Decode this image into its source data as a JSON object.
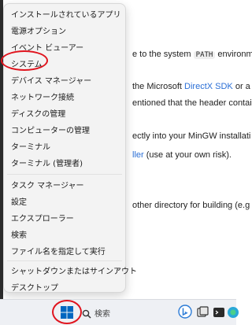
{
  "background_doc": {
    "line1_text": "e to the system",
    "line1_code": "PATH",
    "line1_rest": "environme",
    "line2_text": "the Microsoft",
    "line2_link": "DirectX SDK",
    "line2_rest": "or a",
    "line3_text": "entioned that the header contain",
    "line4_text": "ectly into your MinGW installati",
    "line5_link": "ller",
    "line5_rest": "(use at your own risk).",
    "line6_text": "other directory for building (e.g"
  },
  "menu": {
    "items": [
      {
        "label": "インストールされているアプリ"
      },
      {
        "label": "電源オプション"
      },
      {
        "label": "イベント ビューアー"
      },
      {
        "label": "システム"
      },
      {
        "label": "デバイス マネージャー"
      },
      {
        "label": "ネットワーク接続"
      },
      {
        "label": "ディスクの管理"
      },
      {
        "label": "コンピューターの管理"
      },
      {
        "label": "ターミナル"
      },
      {
        "label": "ターミナル (管理者)"
      },
      {
        "label": "タスク マネージャー"
      },
      {
        "label": "設定"
      },
      {
        "label": "エクスプローラー"
      },
      {
        "label": "検索"
      },
      {
        "label": "ファイル名を指定して実行"
      },
      {
        "label": "シャットダウンまたはサインアウト"
      },
      {
        "label": "デスクトップ"
      }
    ],
    "submenu_arrow": "›"
  },
  "taskbar": {
    "search_label": "検索",
    "icons": [
      "windows-start-icon",
      "search-icon",
      "bing-icon",
      "task-view-icon",
      "terminal-icon",
      "browser-icon"
    ]
  },
  "colors": {
    "annotation": "#e0141e",
    "accent_blue": "#0067c0",
    "link": "#2b6fd6"
  }
}
